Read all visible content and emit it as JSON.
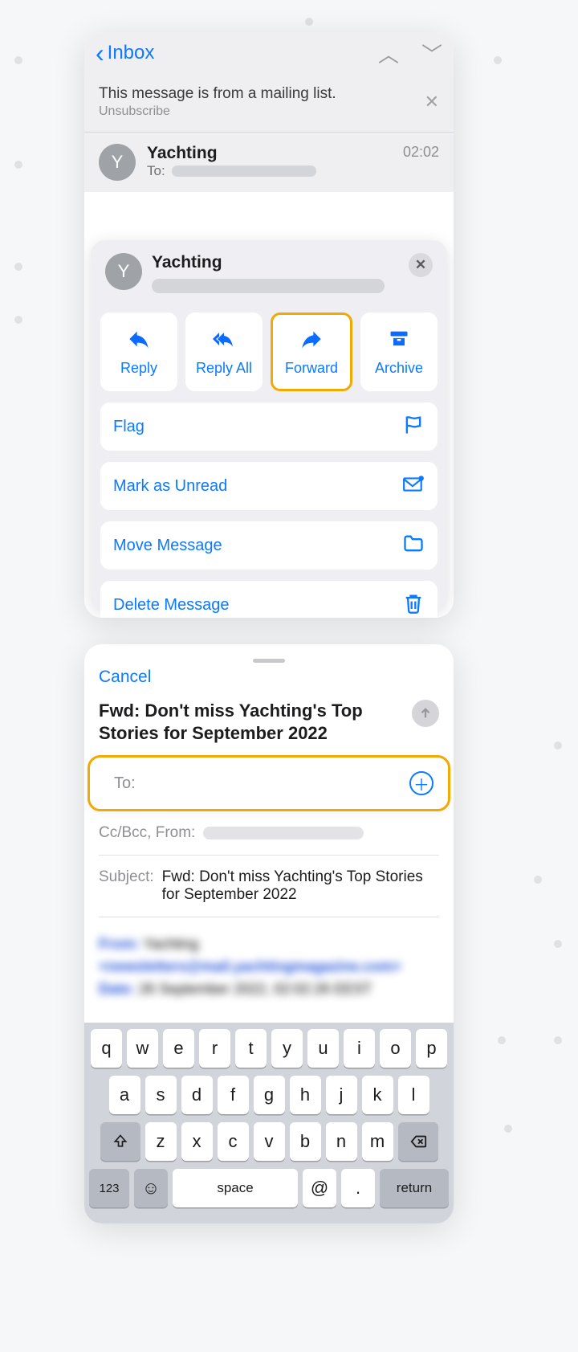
{
  "nav": {
    "back": "Inbox"
  },
  "mailing": {
    "line1": "This message is from a mailing list.",
    "line2": "Unsubscribe"
  },
  "header": {
    "avatar": "Y",
    "sender": "Yachting",
    "to_label": "To:",
    "time": "02:02"
  },
  "sheet": {
    "avatar": "Y",
    "sender": "Yachting",
    "actions": {
      "reply": "Reply",
      "reply_all": "Reply All",
      "forward": "Forward",
      "archive": "Archive"
    },
    "rows": {
      "flag": "Flag",
      "unread": "Mark as Unread",
      "move": "Move Message",
      "delete": "Delete Message"
    }
  },
  "compose": {
    "cancel": "Cancel",
    "title": "Fwd: Don't miss Yachting's Top Stories for September 2022",
    "to_label": "To:",
    "ccbcc": "Cc/Bcc, From:",
    "subject_label": "Subject:",
    "subject_value": "Fwd: Don't miss Yachting's Top Stories for September 2022",
    "body_from_label": "From:",
    "body_from_value": "Yachting",
    "body_email": "<newsletters@mail.yachtingmagazine.com>",
    "body_date_label": "Date:",
    "body_date_value": "26 September 2022, 02:02:26 EEST"
  },
  "kb": {
    "r1": [
      "q",
      "w",
      "e",
      "r",
      "t",
      "y",
      "u",
      "i",
      "o",
      "p"
    ],
    "r2": [
      "a",
      "s",
      "d",
      "f",
      "g",
      "h",
      "j",
      "k",
      "l"
    ],
    "r3": [
      "z",
      "x",
      "c",
      "v",
      "b",
      "n",
      "m"
    ],
    "n123": "123",
    "space": "space",
    "at": "@",
    "dot": ".",
    "ret": "return"
  }
}
